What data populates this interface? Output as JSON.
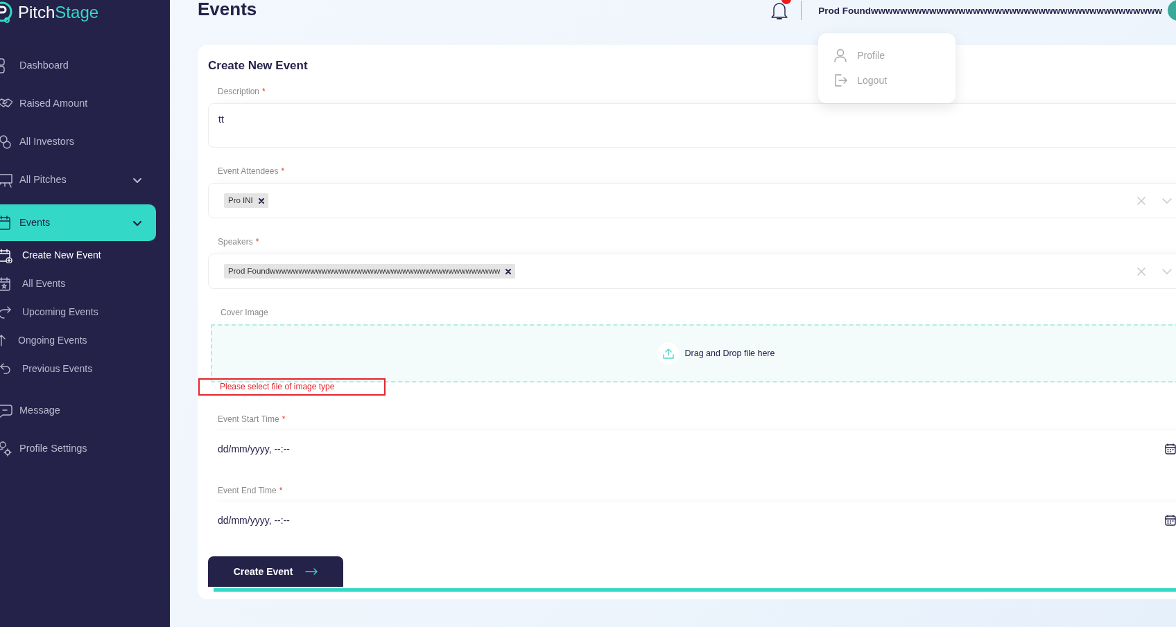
{
  "logo": {
    "first": "Pitch",
    "second": "Stage"
  },
  "sidebar": {
    "items": [
      {
        "label": "Dashboard",
        "selected": false
      },
      {
        "label": "Raised Amount",
        "selected": false
      },
      {
        "label": "All Investors",
        "selected": false
      },
      {
        "label": "All Pitches",
        "selected": false,
        "expanded": false
      },
      {
        "label": "Events",
        "selected": true,
        "expanded": true,
        "children": [
          {
            "label": "Create New Event",
            "selected": true
          },
          {
            "label": "All Events",
            "selected": false
          },
          {
            "label": "Upcoming Events",
            "selected": false
          },
          {
            "label": "Ongoing Events",
            "selected": false
          },
          {
            "label": "Previous Events",
            "selected": false
          }
        ]
      },
      {
        "label": "Message",
        "selected": false
      },
      {
        "label": "Profile Settings",
        "selected": false
      }
    ]
  },
  "header": {
    "title": "Events",
    "user_name": "Prod Foundwwwwwwwwwwwwwwwwwwwwwwwwwwwwwwwwwwwwwwww"
  },
  "user_menu": {
    "open": true,
    "items": [
      "Profile",
      "Logout"
    ]
  },
  "form": {
    "title": "Create New Event",
    "fields": [
      {
        "kind": "textarea",
        "label": "Description",
        "required_mark": "*",
        "value": "tt"
      },
      {
        "kind": "multiselect",
        "label": "Event Attendees",
        "required_mark": "*",
        "chips": [
          "Pro INI"
        ]
      },
      {
        "kind": "multiselect",
        "label": "Speakers",
        "required_mark": "*",
        "chips": [
          "Prod Foundwwwwwwwwwwwwwwwwwwwwwwwwwwwwwwwwwwwwwwww"
        ]
      },
      {
        "kind": "dropzone",
        "label": "Cover Image",
        "prompt": "Drag and Drop file here",
        "error": "Please select file of image type"
      },
      {
        "kind": "datetime",
        "label": "Event Start Time",
        "required_mark": "*",
        "value": "dd/mm/yyyy, --:--"
      },
      {
        "kind": "datetime",
        "label": "Event End Time",
        "required_mark": "*",
        "value": "dd/mm/yyyy, --:--"
      }
    ],
    "submit": "Create Event"
  }
}
